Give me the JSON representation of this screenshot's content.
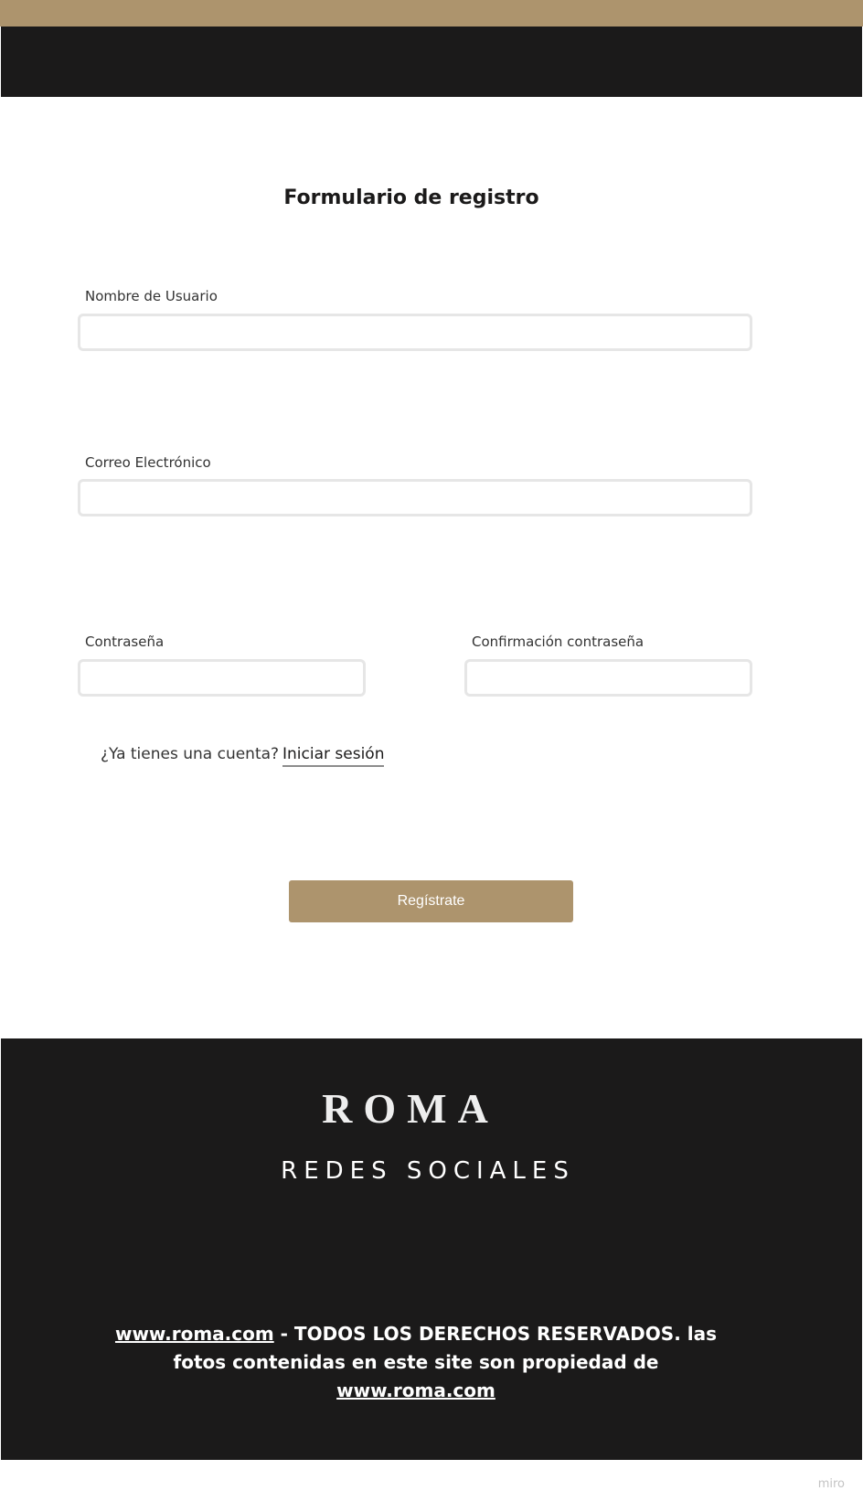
{
  "form": {
    "title": "Formulario de registro",
    "username_label": "Nombre de Usuario",
    "email_label": "Correo Electrónico",
    "password_label": "Contraseña",
    "confirm_password_label": "Confirmación contraseña"
  },
  "account": {
    "question": "¿Ya tienes una cuenta?",
    "login_link": "Iniciar sesión"
  },
  "register_button": "Regístrate",
  "footer": {
    "brand": "ROMA",
    "social_heading": "REDES SOCIALES",
    "site_link": "www.roma.com",
    "rights_text": " - TODOS LOS DERECHOS RESERVADOS. las fotos contenidas en este site son propiedad de ",
    "site_link_2": "www.roma.com"
  },
  "watermark": "miro",
  "colors": {
    "accent": "#ad946d",
    "dark": "#1b1a1a"
  }
}
